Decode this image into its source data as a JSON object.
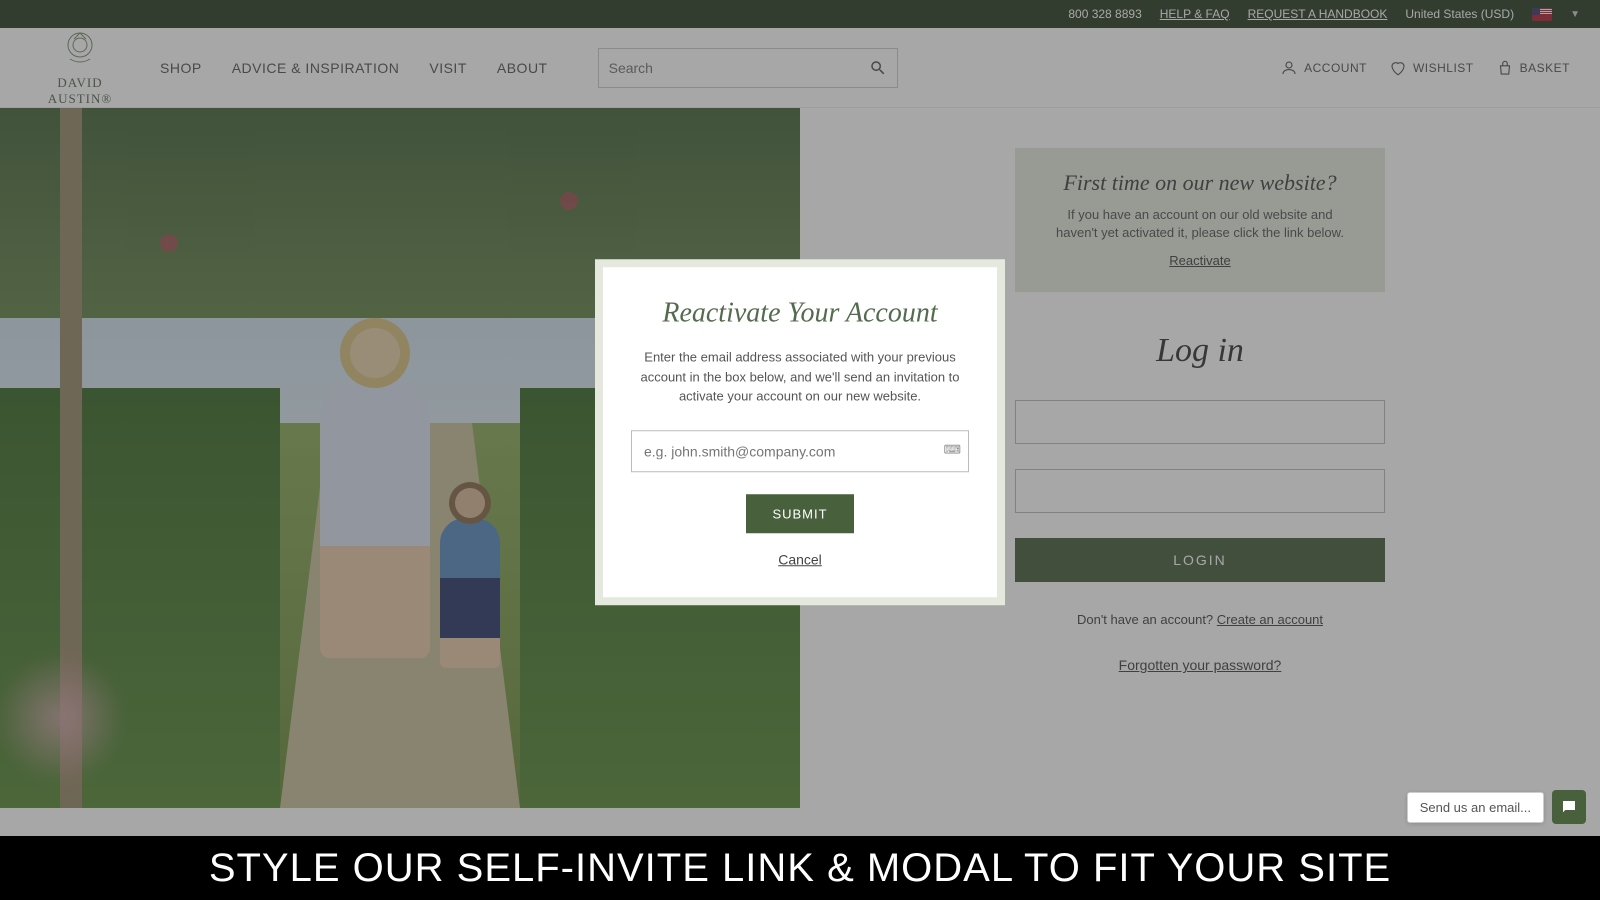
{
  "topbar": {
    "phone": "800 328 8893",
    "help": "HELP & FAQ",
    "handbook": "REQUEST A HANDBOOK",
    "region": "United States (USD)"
  },
  "logo": {
    "text": "DAVID AUSTIN®"
  },
  "nav": {
    "shop": "SHOP",
    "advice": "ADVICE & INSPIRATION",
    "visit": "VISIT",
    "about": "ABOUT"
  },
  "search": {
    "placeholder": "Search"
  },
  "header_right": {
    "account": "ACCOUNT",
    "wishlist": "WISHLIST",
    "basket": "BASKET"
  },
  "first_time": {
    "title": "First time on our new website?",
    "body": "If you have an account on our old website and haven't yet activated it, please click the link below.",
    "link": "Reactivate"
  },
  "login": {
    "title": "Log in",
    "button": "LOGIN",
    "no_account": "Don't have an account? ",
    "create": "Create an account",
    "forgot": "Forgotten your password?"
  },
  "modal": {
    "title": "Reactivate Your Account",
    "body": "Enter the email address associated with your previous account in the box below, and we'll send an invitation to activate your account on our new website.",
    "placeholder": "e.g. john.smith@company.com",
    "submit": "SUBMIT",
    "cancel": "Cancel"
  },
  "chat": {
    "pill": "Send us an email..."
  },
  "banner": {
    "text": "STYLE OUR SELF-INVITE LINK & MODAL TO FIT YOUR SITE"
  }
}
